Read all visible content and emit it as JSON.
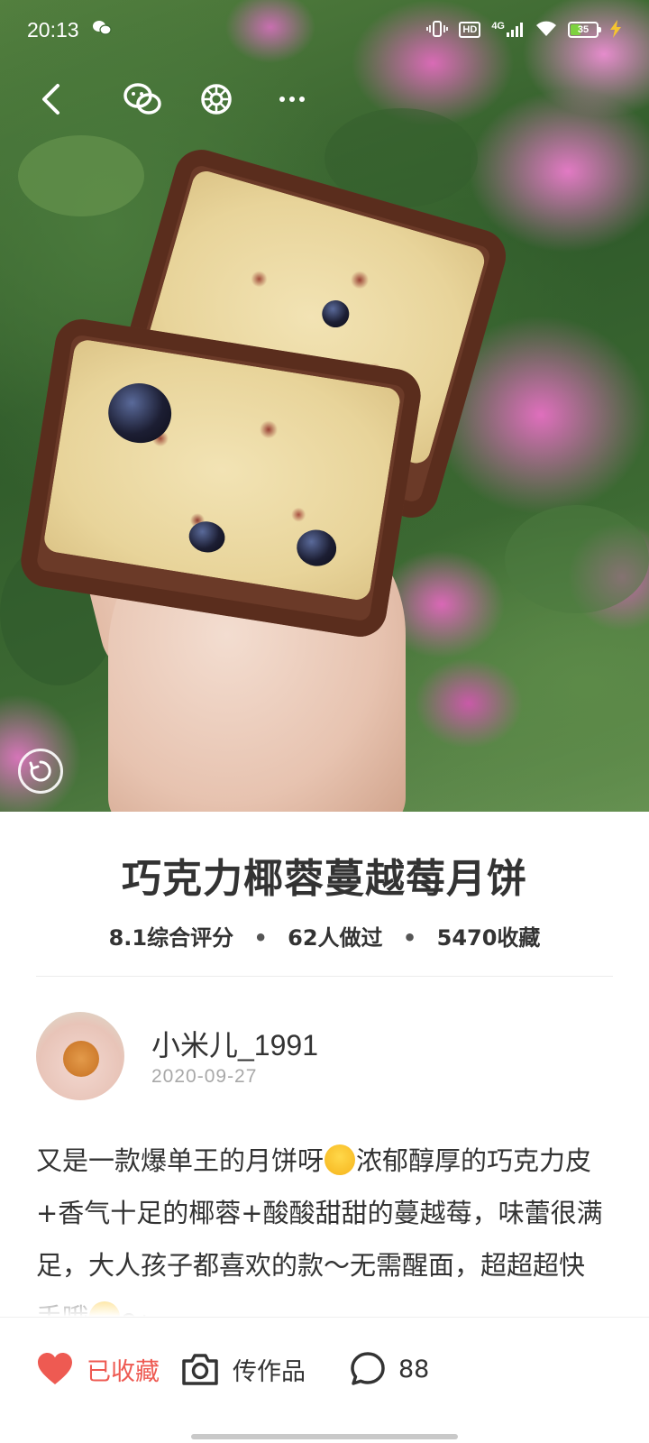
{
  "status_bar": {
    "time": "20:13",
    "network": "4G",
    "hd_label": "HD",
    "battery_level": "35",
    "battery_color": "#7dd23f"
  },
  "toolbar": {
    "back_icon": "chevron-left-icon",
    "share_wechat_icon": "wechat-icon",
    "share_moments_icon": "moments-icon",
    "more_icon": "more-icon"
  },
  "recipe": {
    "title": "巧克力椰蓉蔓越莓月饼",
    "rating": "8.1综合评分",
    "made_count": "62人做过",
    "favorite_count": "5470收藏",
    "stat_separator": "•"
  },
  "author": {
    "name": "小米儿_1991",
    "date": "2020-09-27"
  },
  "description": {
    "part1": "又是一款爆单王的月饼呀",
    "part2": "浓郁醇厚的巧克力皮+香气十足的椰蓉+酸酸甜甜的蔓越莓，味蕾很满足，大人孩子都喜欢的款～无需醒面，超超超快手哦",
    "part3": "～"
  },
  "bottom_bar": {
    "favorite_label": "已收藏",
    "upload_label": "传作品",
    "comment_count": "88",
    "accent_color": "#ee5a52"
  }
}
